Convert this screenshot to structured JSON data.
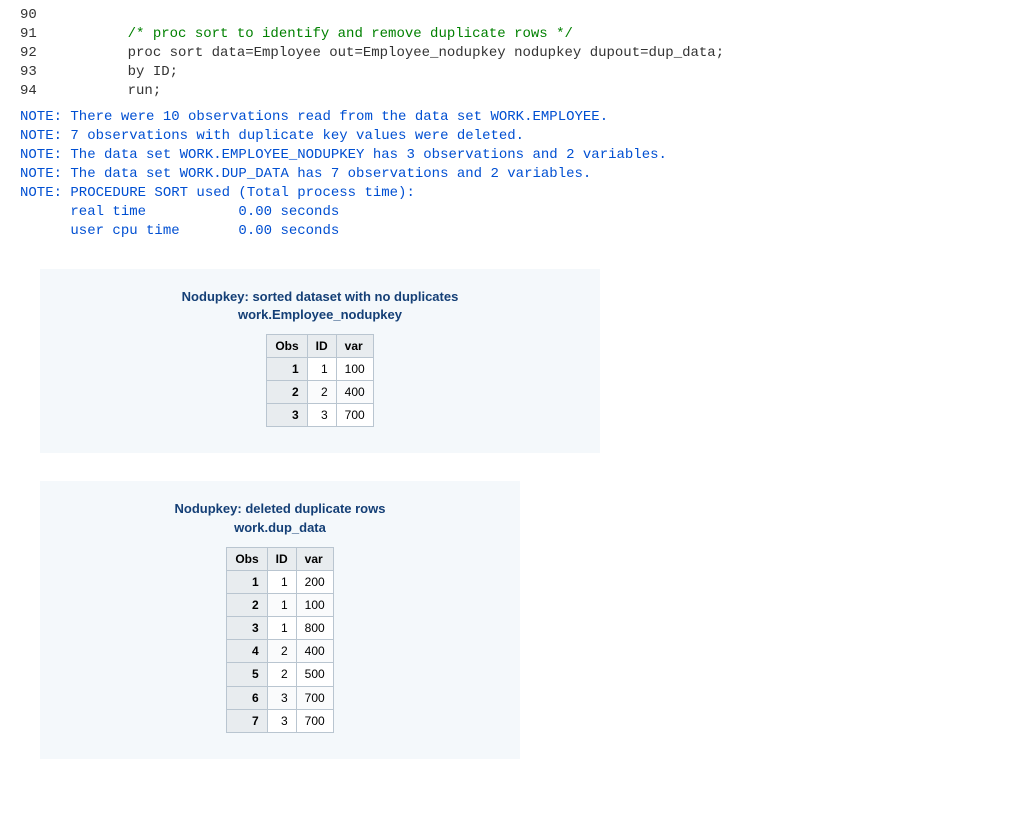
{
  "code": {
    "lines": [
      {
        "n": "90",
        "txt": ""
      },
      {
        "n": "91",
        "txt": "         /* proc sort to identify and remove duplicate rows */"
      },
      {
        "n": "92",
        "txt": "         proc sort data=Employee out=Employee_nodupkey nodupkey dupout=dup_data;"
      },
      {
        "n": "93",
        "txt": "         by ID;"
      },
      {
        "n": "94",
        "txt": "         run;"
      }
    ]
  },
  "notes": [
    "NOTE: There were 10 observations read from the data set WORK.EMPLOYEE.",
    "NOTE: 7 observations with duplicate key values were deleted.",
    "NOTE: The data set WORK.EMPLOYEE_NODUPKEY has 3 observations and 2 variables.",
    "NOTE: The data set WORK.DUP_DATA has 7 observations and 2 variables.",
    "NOTE: PROCEDURE SORT used (Total process time):",
    "      real time           0.00 seconds",
    "      user cpu time       0.00 seconds"
  ],
  "panel1": {
    "title": "Nodupkey: sorted dataset with no duplicates",
    "subtitle": "work.Employee_nodupkey",
    "headers": [
      "Obs",
      "ID",
      "var"
    ],
    "rows": [
      [
        "1",
        "1",
        "100"
      ],
      [
        "2",
        "2",
        "400"
      ],
      [
        "3",
        "3",
        "700"
      ]
    ]
  },
  "panel2": {
    "title": "Nodupkey: deleted duplicate rows",
    "subtitle": "work.dup_data",
    "headers": [
      "Obs",
      "ID",
      "var"
    ],
    "rows": [
      [
        "1",
        "1",
        "200"
      ],
      [
        "2",
        "1",
        "100"
      ],
      [
        "3",
        "1",
        "800"
      ],
      [
        "4",
        "2",
        "400"
      ],
      [
        "5",
        "2",
        "500"
      ],
      [
        "6",
        "3",
        "700"
      ],
      [
        "7",
        "3",
        "700"
      ]
    ]
  }
}
